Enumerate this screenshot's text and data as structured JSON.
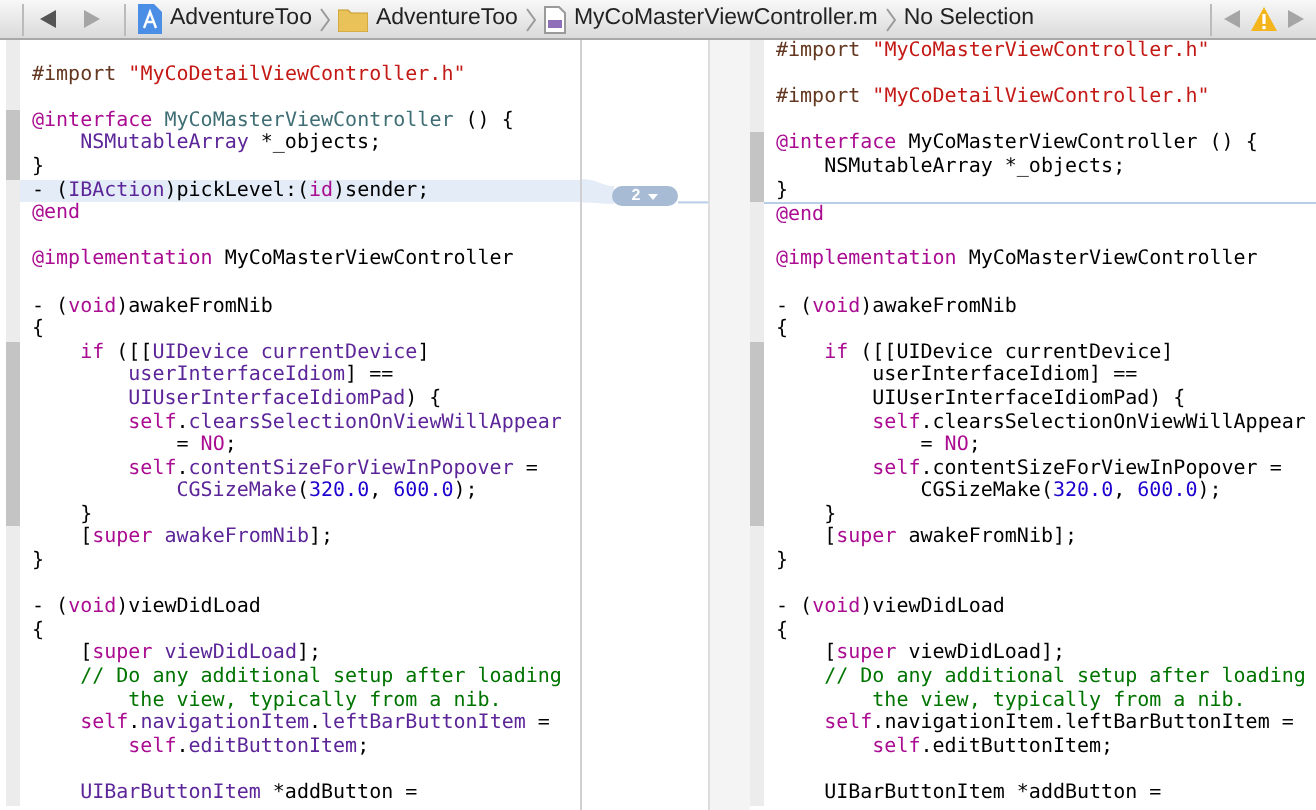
{
  "jump_bar": {
    "back_enabled": true,
    "forward_enabled": false,
    "path": [
      {
        "kind": "project",
        "label": "AdventureToo"
      },
      {
        "kind": "folder",
        "label": "AdventureToo"
      },
      {
        "kind": "source-file",
        "label": "MyCoMasterViewController.m"
      },
      {
        "kind": "symbol",
        "label": "No Selection"
      }
    ],
    "issue_back_enabled": false,
    "issue_forward_enabled": false
  },
  "left_editor": {
    "lines": [
      {
        "changed": false,
        "highlighted": false
      },
      {
        "tokens": [
          {
            "kind": "directive",
            "text": "#import "
          },
          {
            "kind": "string",
            "text": "\"MyCoDetailViewController.h\""
          }
        ],
        "changed": false,
        "highlighted": false
      },
      {
        "changed": false,
        "highlighted": false
      },
      {
        "tokens": [
          {
            "kind": "keyword",
            "text": "@interface"
          },
          {
            "kind": "project",
            "text": " MyCoMasterViewController"
          },
          {
            "kind": "plain",
            "text": " () {"
          }
        ],
        "changed": true,
        "highlighted": false
      },
      {
        "tokens": [
          {
            "kind": "class",
            "text": "    NSMutableArray"
          },
          {
            "kind": "plain",
            "text": " *_objects;"
          }
        ],
        "changed": true,
        "highlighted": false
      },
      {
        "tokens": [
          {
            "kind": "plain",
            "text": "}"
          }
        ],
        "changed": true,
        "highlighted": false
      },
      {
        "tokens": [
          {
            "kind": "plain",
            "text": "- ("
          },
          {
            "kind": "class",
            "text": "IBAction"
          },
          {
            "kind": "plain",
            "text": ")pickLevel:("
          },
          {
            "kind": "keyword",
            "text": "id"
          },
          {
            "kind": "plain",
            "text": ")sender;"
          }
        ],
        "changed": false,
        "highlighted": true
      },
      {
        "tokens": [
          {
            "kind": "keyword",
            "text": "@end"
          }
        ],
        "changed": false,
        "highlighted": false
      },
      {
        "changed": false,
        "highlighted": false
      },
      {
        "tokens": [
          {
            "kind": "keyword",
            "text": "@implementation"
          },
          {
            "kind": "plain",
            "text": " MyCoMasterViewController"
          }
        ],
        "changed": false,
        "highlighted": false
      },
      {
        "changed": false,
        "highlighted": false
      },
      {
        "tokens": [
          {
            "kind": "plain",
            "text": "- ("
          },
          {
            "kind": "keyword",
            "text": "void"
          },
          {
            "kind": "plain",
            "text": ")awakeFromNib"
          }
        ],
        "changed": false,
        "highlighted": false
      },
      {
        "tokens": [
          {
            "kind": "plain",
            "text": "{"
          }
        ],
        "changed": false,
        "highlighted": false
      },
      {
        "tokens": [
          {
            "kind": "keyword",
            "text": "    if"
          },
          {
            "kind": "plain",
            "text": " ([["
          },
          {
            "kind": "class",
            "text": "UIDevice"
          },
          {
            "kind": "class",
            "text": " currentDevice"
          },
          {
            "kind": "plain",
            "text": "]"
          }
        ],
        "changed": true,
        "highlighted": false
      },
      {
        "tokens": [
          {
            "kind": "class",
            "text": "        userInterfaceIdiom"
          },
          {
            "kind": "plain",
            "text": "] =="
          }
        ],
        "changed": true,
        "highlighted": false
      },
      {
        "tokens": [
          {
            "kind": "class",
            "text": "        UIUserInterfaceIdiomPad"
          },
          {
            "kind": "plain",
            "text": ") {"
          }
        ],
        "changed": true,
        "highlighted": false
      },
      {
        "tokens": [
          {
            "kind": "keyword",
            "text": "        self"
          },
          {
            "kind": "plain",
            "text": "."
          },
          {
            "kind": "class",
            "text": "clearsSelectionOnViewWillAppear"
          }
        ],
        "changed": true,
        "highlighted": false
      },
      {
        "tokens": [
          {
            "kind": "plain",
            "text": "            = "
          },
          {
            "kind": "keyword",
            "text": "NO"
          },
          {
            "kind": "plain",
            "text": ";"
          }
        ],
        "changed": true,
        "highlighted": false
      },
      {
        "tokens": [
          {
            "kind": "keyword",
            "text": "        self"
          },
          {
            "kind": "plain",
            "text": "."
          },
          {
            "kind": "class",
            "text": "contentSizeForViewInPopover"
          },
          {
            "kind": "plain",
            "text": " ="
          }
        ],
        "changed": true,
        "highlighted": false
      },
      {
        "tokens": [
          {
            "kind": "class",
            "text": "            CGSizeMake"
          },
          {
            "kind": "plain",
            "text": "("
          },
          {
            "kind": "number",
            "text": "320.0"
          },
          {
            "kind": "plain",
            "text": ", "
          },
          {
            "kind": "number",
            "text": "600.0"
          },
          {
            "kind": "plain",
            "text": ");"
          }
        ],
        "changed": true,
        "highlighted": false
      },
      {
        "tokens": [
          {
            "kind": "plain",
            "text": "    }"
          }
        ],
        "changed": true,
        "highlighted": false
      },
      {
        "tokens": [
          {
            "kind": "plain",
            "text": "    ["
          },
          {
            "kind": "keyword",
            "text": "super"
          },
          {
            "kind": "class",
            "text": " awakeFromNib"
          },
          {
            "kind": "plain",
            "text": "];"
          }
        ],
        "changed": false,
        "highlighted": false
      },
      {
        "tokens": [
          {
            "kind": "plain",
            "text": "}"
          }
        ],
        "changed": false,
        "highlighted": false
      },
      {
        "changed": false,
        "highlighted": false
      },
      {
        "tokens": [
          {
            "kind": "plain",
            "text": "- ("
          },
          {
            "kind": "keyword",
            "text": "void"
          },
          {
            "kind": "plain",
            "text": ")viewDidLoad"
          }
        ],
        "changed": false,
        "highlighted": false
      },
      {
        "tokens": [
          {
            "kind": "plain",
            "text": "{"
          }
        ],
        "changed": false,
        "highlighted": false
      },
      {
        "tokens": [
          {
            "kind": "plain",
            "text": "    ["
          },
          {
            "kind": "keyword",
            "text": "super"
          },
          {
            "kind": "class",
            "text": " viewDidLoad"
          },
          {
            "kind": "plain",
            "text": "];"
          }
        ],
        "changed": false,
        "highlighted": false
      },
      {
        "tokens": [
          {
            "kind": "comment",
            "text": "    // Do any additional setup after loading"
          }
        ],
        "changed": false,
        "highlighted": false
      },
      {
        "tokens": [
          {
            "kind": "comment",
            "text": "        the view, typically from a nib."
          }
        ],
        "changed": false,
        "highlighted": false
      },
      {
        "tokens": [
          {
            "kind": "keyword",
            "text": "    self"
          },
          {
            "kind": "plain",
            "text": "."
          },
          {
            "kind": "class",
            "text": "navigationItem"
          },
          {
            "kind": "plain",
            "text": "."
          },
          {
            "kind": "class",
            "text": "leftBarButtonItem"
          },
          {
            "kind": "plain",
            "text": " ="
          }
        ],
        "changed": false,
        "highlighted": false
      },
      {
        "tokens": [
          {
            "kind": "keyword",
            "text": "        self"
          },
          {
            "kind": "plain",
            "text": "."
          },
          {
            "kind": "class",
            "text": "editButtonItem"
          },
          {
            "kind": "plain",
            "text": ";"
          }
        ],
        "changed": false,
        "highlighted": false
      },
      {
        "changed": false,
        "highlighted": false
      },
      {
        "tokens": [
          {
            "kind": "class",
            "text": "    UIBarButtonItem"
          },
          {
            "kind": "plain",
            "text": " *addButton ="
          }
        ],
        "changed": false,
        "highlighted": false
      }
    ]
  },
  "change_badge": {
    "label": "2"
  },
  "right_editor": {
    "lines": [
      {
        "tokens": [
          {
            "kind": "directive",
            "text": "#import "
          },
          {
            "kind": "string",
            "text": "\"MyCoMasterViewController.h\""
          }
        ],
        "changed": false,
        "insertion_point": false
      },
      {
        "changed": false,
        "insertion_point": false
      },
      {
        "tokens": [
          {
            "kind": "directive",
            "text": "#import "
          },
          {
            "kind": "string",
            "text": "\"MyCoDetailViewController.h\""
          }
        ],
        "changed": false,
        "insertion_point": false
      },
      {
        "changed": false,
        "insertion_point": false
      },
      {
        "tokens": [
          {
            "kind": "keyword",
            "text": "@interface"
          },
          {
            "kind": "plain",
            "text": " MyCoMasterViewController () {"
          }
        ],
        "changed": true,
        "insertion_point": false
      },
      {
        "tokens": [
          {
            "kind": "plain",
            "text": "    NSMutableArray *_objects;"
          }
        ],
        "changed": true,
        "insertion_point": false
      },
      {
        "tokens": [
          {
            "kind": "plain",
            "text": "}"
          }
        ],
        "changed": true,
        "insertion_point": false
      },
      {
        "tokens": [
          {
            "kind": "keyword",
            "text": "@end"
          }
        ],
        "changed": false,
        "insertion_point": true
      },
      {
        "changed": false,
        "insertion_point": false
      },
      {
        "tokens": [
          {
            "kind": "keyword",
            "text": "@implementation"
          },
          {
            "kind": "plain",
            "text": " MyCoMasterViewController"
          }
        ],
        "changed": false,
        "insertion_point": false
      },
      {
        "changed": false,
        "insertion_point": false
      },
      {
        "tokens": [
          {
            "kind": "plain",
            "text": "- ("
          },
          {
            "kind": "keyword",
            "text": "void"
          },
          {
            "kind": "plain",
            "text": ")awakeFromNib"
          }
        ],
        "changed": false,
        "insertion_point": false
      },
      {
        "tokens": [
          {
            "kind": "plain",
            "text": "{"
          }
        ],
        "changed": false,
        "insertion_point": false
      },
      {
        "tokens": [
          {
            "kind": "keyword",
            "text": "    if"
          },
          {
            "kind": "plain",
            "text": " ([[UIDevice currentDevice]"
          }
        ],
        "changed": true,
        "insertion_point": false
      },
      {
        "tokens": [
          {
            "kind": "plain",
            "text": "        userInterfaceIdiom] =="
          }
        ],
        "changed": true,
        "insertion_point": false
      },
      {
        "tokens": [
          {
            "kind": "plain",
            "text": "        UIUserInterfaceIdiomPad) {"
          }
        ],
        "changed": true,
        "insertion_point": false
      },
      {
        "tokens": [
          {
            "kind": "keyword",
            "text": "        self"
          },
          {
            "kind": "plain",
            "text": ".clearsSelectionOnViewWillAppear"
          }
        ],
        "changed": true,
        "insertion_point": false
      },
      {
        "tokens": [
          {
            "kind": "plain",
            "text": "            = "
          },
          {
            "kind": "keyword",
            "text": "NO"
          },
          {
            "kind": "plain",
            "text": ";"
          }
        ],
        "changed": true,
        "insertion_point": false
      },
      {
        "tokens": [
          {
            "kind": "keyword",
            "text": "        self"
          },
          {
            "kind": "plain",
            "text": ".contentSizeForViewInPopover ="
          }
        ],
        "changed": true,
        "insertion_point": false
      },
      {
        "tokens": [
          {
            "kind": "plain",
            "text": "            CGSizeMake("
          },
          {
            "kind": "number",
            "text": "320.0"
          },
          {
            "kind": "plain",
            "text": ", "
          },
          {
            "kind": "number",
            "text": "600.0"
          },
          {
            "kind": "plain",
            "text": ");"
          }
        ],
        "changed": true,
        "insertion_point": false
      },
      {
        "tokens": [
          {
            "kind": "plain",
            "text": "    }"
          }
        ],
        "changed": true,
        "insertion_point": false
      },
      {
        "tokens": [
          {
            "kind": "plain",
            "text": "    ["
          },
          {
            "kind": "keyword",
            "text": "super"
          },
          {
            "kind": "plain",
            "text": " awakeFromNib];"
          }
        ],
        "changed": false,
        "insertion_point": false
      },
      {
        "tokens": [
          {
            "kind": "plain",
            "text": "}"
          }
        ],
        "changed": false,
        "insertion_point": false
      },
      {
        "changed": false,
        "insertion_point": false
      },
      {
        "tokens": [
          {
            "kind": "plain",
            "text": "- ("
          },
          {
            "kind": "keyword",
            "text": "void"
          },
          {
            "kind": "plain",
            "text": ")viewDidLoad"
          }
        ],
        "changed": false,
        "insertion_point": false
      },
      {
        "tokens": [
          {
            "kind": "plain",
            "text": "{"
          }
        ],
        "changed": false,
        "insertion_point": false
      },
      {
        "tokens": [
          {
            "kind": "plain",
            "text": "    ["
          },
          {
            "kind": "keyword",
            "text": "super"
          },
          {
            "kind": "plain",
            "text": " viewDidLoad];"
          }
        ],
        "changed": false,
        "insertion_point": false
      },
      {
        "tokens": [
          {
            "kind": "comment",
            "text": "    // Do any additional setup after loading"
          }
        ],
        "changed": false,
        "insertion_point": false
      },
      {
        "tokens": [
          {
            "kind": "comment",
            "text": "        the view, typically from a nib."
          }
        ],
        "changed": false,
        "insertion_point": false
      },
      {
        "tokens": [
          {
            "kind": "keyword",
            "text": "    self"
          },
          {
            "kind": "plain",
            "text": ".navigationItem.leftBarButtonItem ="
          }
        ],
        "changed": false,
        "insertion_point": false
      },
      {
        "tokens": [
          {
            "kind": "keyword",
            "text": "        self"
          },
          {
            "kind": "plain",
            "text": ".editButtonItem;"
          }
        ],
        "changed": false,
        "insertion_point": false
      },
      {
        "changed": false,
        "insertion_point": false
      },
      {
        "tokens": [
          {
            "kind": "plain",
            "text": "    UIBarButtonItem *addButton ="
          }
        ],
        "changed": false,
        "insertion_point": false
      }
    ]
  }
}
